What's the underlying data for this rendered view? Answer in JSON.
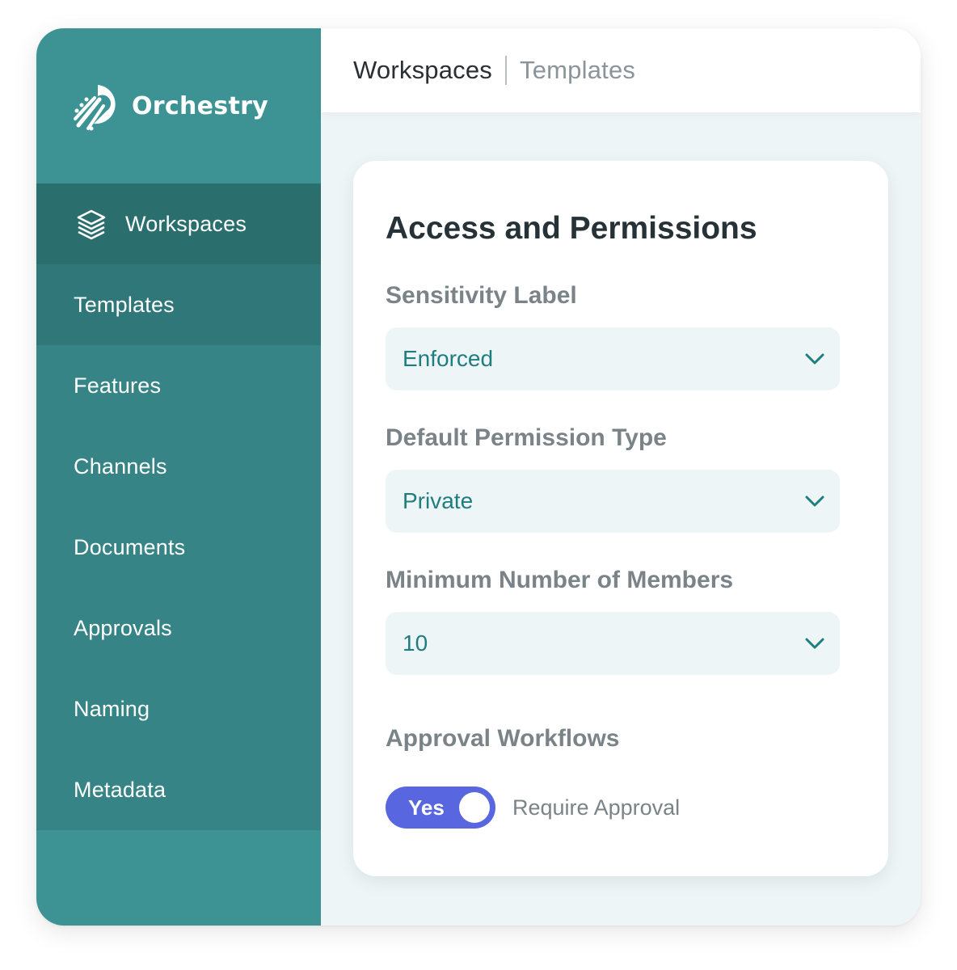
{
  "app": {
    "name": "Orchestry"
  },
  "breadcrumb": {
    "current": "Workspaces",
    "other": "Templates"
  },
  "sidebar": {
    "items": [
      {
        "label": "Workspaces",
        "icon": "layers-icon"
      },
      {
        "label": "Templates"
      },
      {
        "label": "Features"
      },
      {
        "label": "Channels"
      },
      {
        "label": "Documents"
      },
      {
        "label": "Approvals"
      },
      {
        "label": "Naming"
      },
      {
        "label": "Metadata"
      }
    ]
  },
  "card": {
    "title": "Access and Permissions",
    "sensitivity": {
      "label": "Sensitivity Label",
      "value": "Enforced"
    },
    "permission": {
      "label": "Default Permission Type",
      "value": "Private"
    },
    "members": {
      "label": "Minimum Number of Members",
      "value": "10"
    },
    "approval": {
      "label": "Approval Workflows",
      "toggle_label": "Yes",
      "toggle_on": true,
      "description": "Require Approval"
    }
  },
  "colors": {
    "sidebar": "#3d9394",
    "sidebar_active": "#2b6e6e",
    "accent_teal": "#1f7d80",
    "toggle": "#5866e0"
  }
}
